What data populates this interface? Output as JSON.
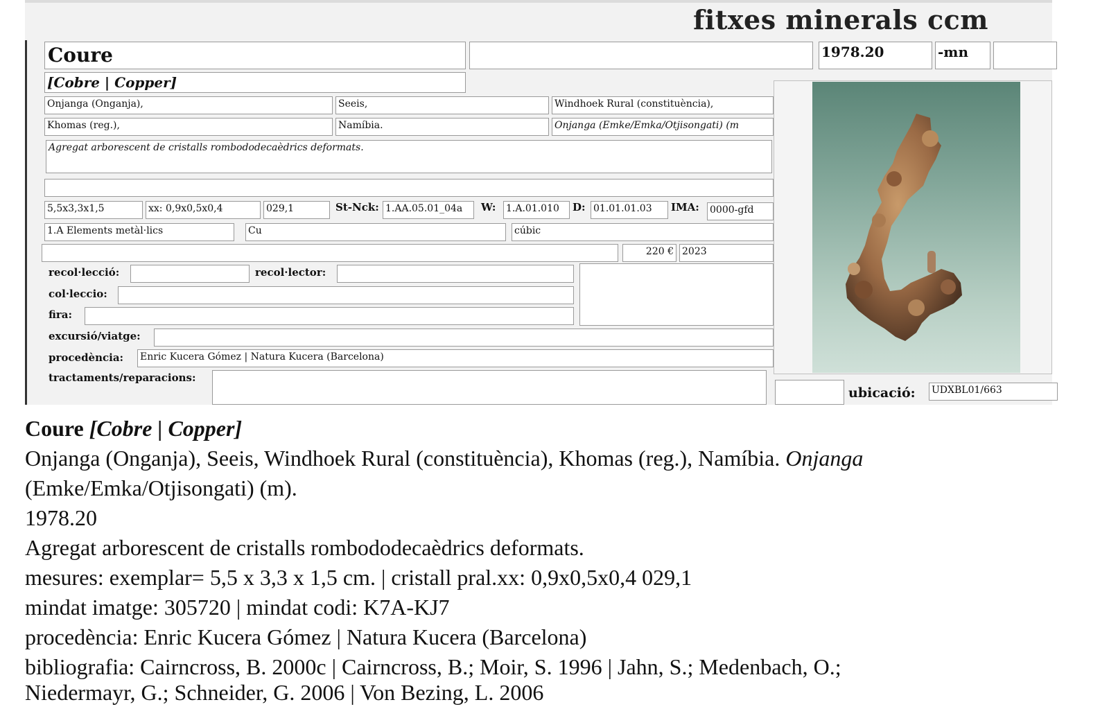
{
  "header": {
    "brand": "fitxes minerals ccm"
  },
  "card": {
    "name": "Coure",
    "synonyms": "[Cobre | Copper]",
    "code": "1978.20",
    "suffix": "-mn",
    "locality": {
      "l1": "Onjanga (Onganja),",
      "l2": "Seeis,",
      "l3": "Windhoek Rural (constituència),",
      "l4": "Khomas (reg.),",
      "l5": "Namíbia.",
      "l6": "Onjanga (Emke/Emka/Otjisongati) (m"
    },
    "description": "Agregat arborescent de cristalls rombododecaèdrics deformats.",
    "measures": "5,5x3,3x1,5",
    "crystal": "xx: 0,9x0,5x0,4",
    "weight": "029,1",
    "strunz_label": "St-Nck:",
    "strunz": "1.AA.05.01_04a",
    "w_label": "W:",
    "w_value": "1.A.01.010",
    "d_label": "D:",
    "d_value": "01.01.01.03",
    "ima_label": "IMA:",
    "ima_value": "0000-gfd",
    "class": "1.A Elements metàl·lics",
    "formula": "Cu",
    "system": "cúbic",
    "price": "220 €",
    "year": "2023",
    "labels": {
      "collection_place": "recol·lecció:",
      "collector": "recol·lector:",
      "collection": "col·leccio:",
      "fair": "fira:",
      "trip": "excursió/viatge:",
      "provenance": "procedència:",
      "treatments": "tractaments/reparacions:",
      "location": "ubicació:"
    },
    "provenance": "Enric Kucera Gómez | Natura Kucera (Barcelona)",
    "location": "UDXBL01/663"
  },
  "caption": {
    "title": "Coure",
    "title_syn": "[Cobre | Copper]",
    "locality": "Onjanga (Onganja), Seeis, Windhoek Rural (constituència), Khomas (reg.), Namíbia.",
    "locality_it_1": "Onjanga",
    "locality_it_2": "(Emke/Emka/Otjisongati) (m).",
    "code": "1978.20",
    "description": "Agregat arborescent de cristalls rombododecaèdrics deformats.",
    "measures": "mesures: exemplar= 5,5 x 3,3 x 1,5 cm. | cristall pral.xx: 0,9x0,5x0,4 029,1",
    "mindat": "mindat imatge: 305720 | mindat codi: K7A-KJ7",
    "provenance": "procedència: Enric Kucera Gómez | Natura Kucera (Barcelona)",
    "biblio_1": "bibliografia: Cairncross, B. 2000c | Cairncross, B.; Moir, S. 1996 | Jahn, S.; Medenbach, O.;",
    "biblio_2": "Niedermayr, G.; Schneider, G. 2006 | Von Bezing, L. 2006"
  }
}
